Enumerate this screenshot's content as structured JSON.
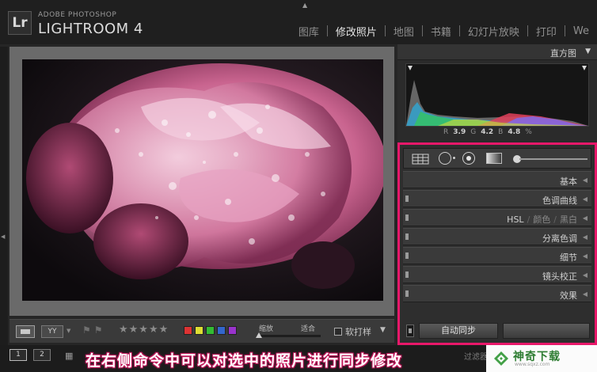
{
  "header": {
    "brand_top": "ADOBE PHOTOSHOP",
    "brand_main": "LIGHTROOM 4",
    "logo_text": "Lr",
    "modules": [
      {
        "label": "图库",
        "active": false
      },
      {
        "label": "修改照片",
        "active": true
      },
      {
        "label": "地图",
        "active": false
      },
      {
        "label": "书籍",
        "active": false
      },
      {
        "label": "幻灯片放映",
        "active": false
      },
      {
        "label": "打印",
        "active": false
      },
      {
        "label": "We",
        "active": false
      }
    ]
  },
  "toolbar": {
    "view_yy": "YY",
    "stars": "★★★★★",
    "color_labels": [
      "#d33",
      "#dd3",
      "#3b3",
      "#36c",
      "#93c"
    ],
    "zoom_label": "缩放",
    "fit_label": "适合",
    "zoom_level": 0,
    "softproof_label": "软打样",
    "caret": "▼"
  },
  "right_panel": {
    "histogram_title": "直方图",
    "histogram_caret": "▼",
    "readout": {
      "r_label": "R",
      "r_value": "3.9",
      "g_label": "G",
      "g_value": "4.2",
      "b_label": "B",
      "b_value": "4.8",
      "unit": "%"
    },
    "sections": {
      "basic": "基本",
      "tone_curve": "色调曲线",
      "hsl": "HSL",
      "hsl_color": "颜色",
      "hsl_bw": "黑白",
      "split_toning": "分离色调",
      "detail": "细节",
      "lens_corrections": "镜头校正",
      "effects": "效果"
    },
    "auto_sync_label": "自动同步"
  },
  "bottombar": {
    "btn1": "1",
    "btn2": "2",
    "grid_icon": "▦",
    "filter_label": "过滤器",
    "caption": "在右侧命令中可以对选中的照片进行同步修改"
  },
  "watermark": {
    "name": "神奇下载",
    "url": "www.sqxz.com"
  }
}
